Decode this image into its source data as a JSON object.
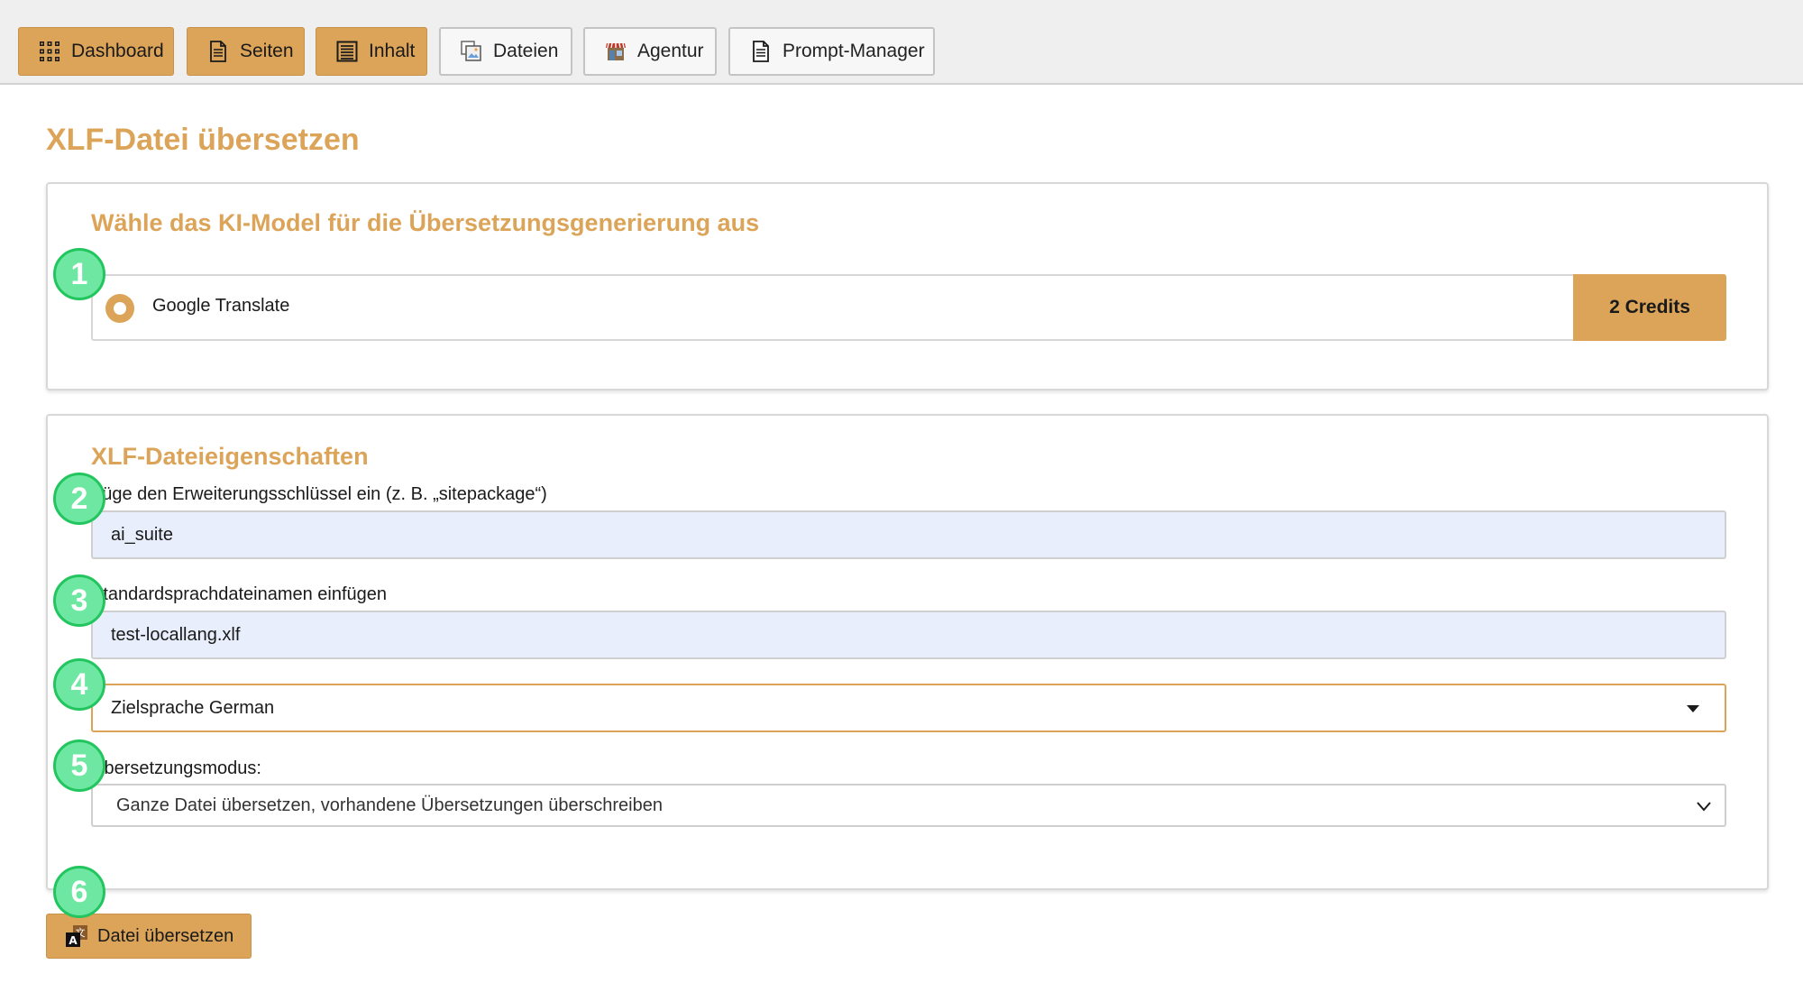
{
  "nav": [
    {
      "label": "Dashboard",
      "icon": "grid-icon",
      "active": true
    },
    {
      "label": "Seiten",
      "icon": "page-icon",
      "active": true
    },
    {
      "label": "Inhalt",
      "icon": "content-list-icon",
      "active": true
    },
    {
      "label": "Dateien",
      "icon": "files-icon",
      "active": false
    },
    {
      "label": "Agentur",
      "icon": "storefront-icon",
      "active": false
    },
    {
      "label": "Prompt-Manager",
      "icon": "document-icon",
      "active": false
    }
  ],
  "page": {
    "title": "XLF-Datei übersetzen"
  },
  "model_section": {
    "title": "Wähle das KI-Model für die Übersetzungsgenerierung aus",
    "option": {
      "label": "Google Translate",
      "selected": true,
      "credits": "2 Credits"
    }
  },
  "properties": {
    "title": "XLF-Dateieigenschaften",
    "extension_label": "Füge den Erweiterungsschlüssel ein (z. B. „sitepackage“)",
    "extension_value": "ai_suite",
    "filename_label": "Standardsprachdateinamen einfügen",
    "filename_value": "test-locallang.xlf",
    "target_language": "Zielsprache German",
    "mode_label": "Übersetzungsmodus:",
    "mode_value": "Ganze Datei übersetzen, vorhandene Übersetzungen überschreiben"
  },
  "submit": {
    "label": "Datei übersetzen"
  },
  "badges": [
    "1",
    "2",
    "3",
    "4",
    "5",
    "6"
  ],
  "colors": {
    "accent": "#dca458",
    "badge": "#6ee7a2",
    "input_bg": "#e8eefc"
  }
}
